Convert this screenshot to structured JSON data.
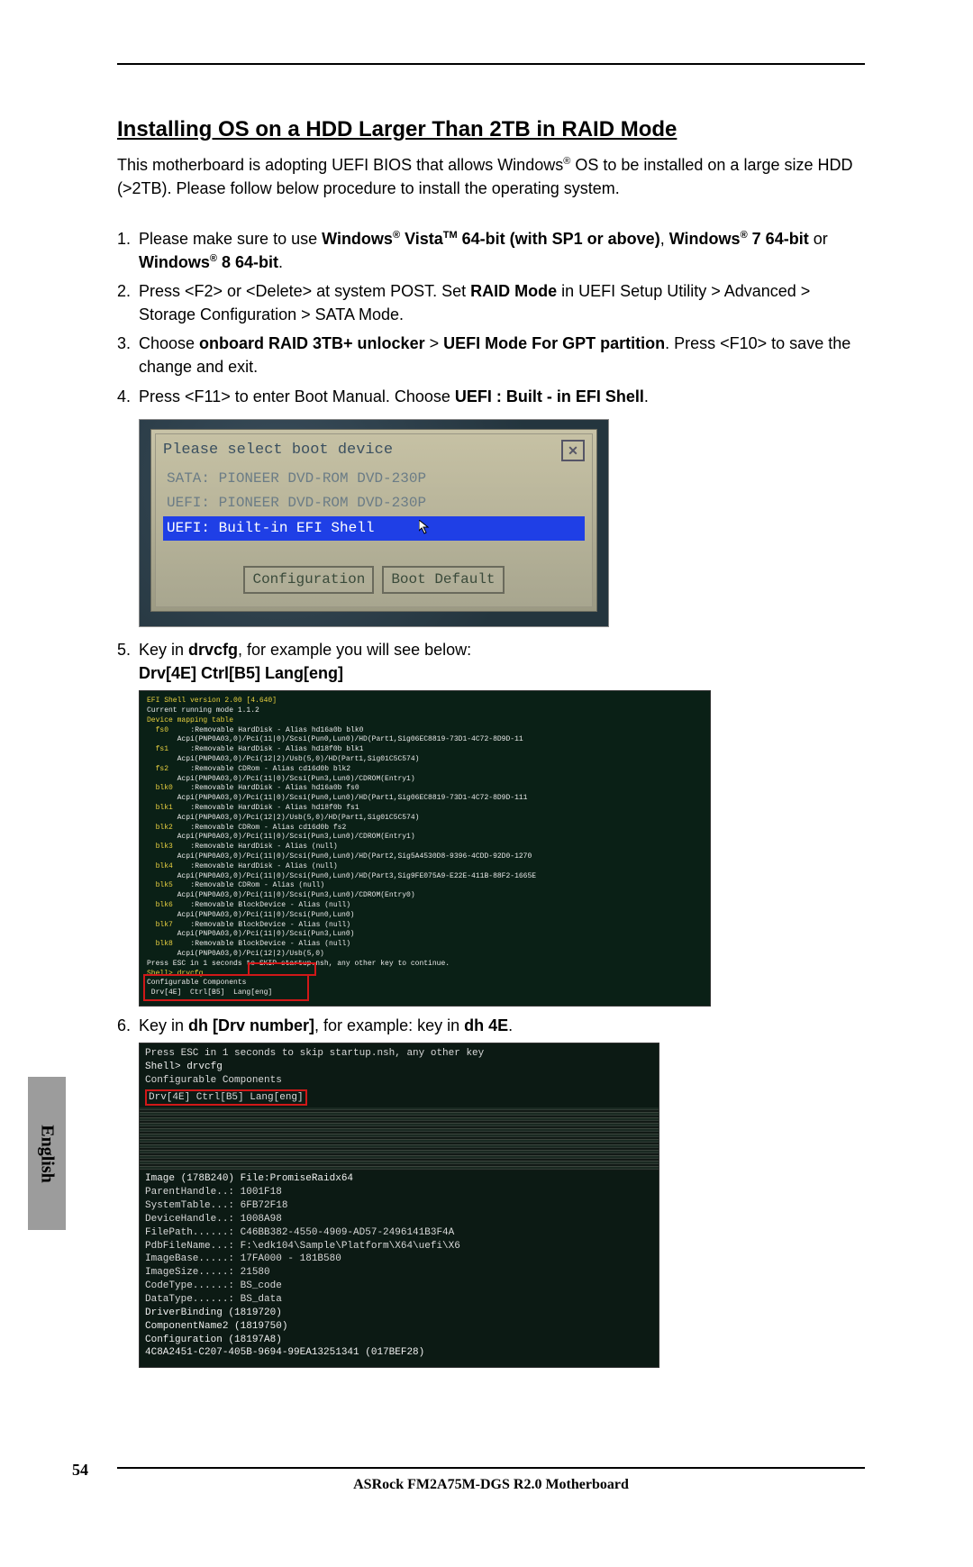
{
  "heading": "Installing OS on a HDD Larger Than 2TB in RAID Mode",
  "intro": {
    "t1": "This motherboard is adopting UEFI BIOS that allows Windows",
    "reg": "®",
    "t2": " OS to be installed on a large size HDD (>2TB). Please follow below procedure to install the operating system."
  },
  "s1": {
    "a": "Please make sure to use ",
    "b": "Windows",
    "c": " Vista",
    "tm": "TM",
    "d": " 64-bit (with SP1 or above)",
    "comma": ", ",
    "e": "Windows",
    "f": " 7 64-bit ",
    "g": "or ",
    "h": "Windows",
    "i": " 8 64-bit",
    "j": "."
  },
  "s2": {
    "a": "Press <F2> or <Delete> at system POST. Set ",
    "b": "RAID Mode",
    "c": " in UEFI Setup Utility > Advanced > Storage Configuration > SATA Mode."
  },
  "s3": {
    "a": "Choose ",
    "b": "onboard RAID 3TB+ unlocker",
    "c": " > ",
    "d": "UEFI Mode For GPT partition",
    "e": ". Press <F10> to save the change and exit."
  },
  "s4": {
    "a": "Press <F11> to enter Boot Manual. Choose ",
    "b": "UEFI : Built - in EFI Shell",
    "c": "."
  },
  "dlg": {
    "title": "Please select boot device",
    "o1": "SATA: PIONEER DVD-ROM DVD-230P",
    "o2": "UEFI: PIONEER DVD-ROM DVD-230P",
    "o3": "UEFI: Built-in EFI Shell",
    "b1": "Configuration",
    "b2": "Boot Default"
  },
  "s5": {
    "a": "Key in ",
    "b": "drvcfg",
    "c": ", for example you will see below:",
    "d": "Drv[4E]   Ctrl[B5]   Lang[eng]"
  },
  "shell": {
    "l1": "EFI Shell version 2.00 [4.640]",
    "l2": "Current running mode 1.1.2",
    "l3": "Device mapping table",
    "rows": [
      {
        "k": "fs0",
        "a": ":Removable HardDisk - Alias hd16a0b blk0",
        "b": "Acpi(PNP0A03,0)/Pci(11|0)/Scsi(Pun0,Lun0)/HD(Part1,Sig06EC8819-73D1-4C72-8D9D-11"
      },
      {
        "k": "fs1",
        "a": ":Removable HardDisk - Alias hd18f0b blk1",
        "b": "Acpi(PNP0A03,0)/Pci(12|2)/Usb(5,0)/HD(Part1,Sig01C5C574)"
      },
      {
        "k": "fs2",
        "a": ":Removable CDRom - Alias cd16d0b blk2",
        "b": "Acpi(PNP0A03,0)/Pci(11|0)/Scsi(Pun3,Lun0)/CDROM(Entry1)"
      },
      {
        "k": "blk0",
        "a": ":Removable HardDisk - Alias hd16a0b fs0",
        "b": "Acpi(PNP0A03,0)/Pci(11|0)/Scsi(Pun0,Lun0)/HD(Part1,Sig06EC8819-73D1-4C72-8D9D-111"
      },
      {
        "k": "blk1",
        "a": ":Removable HardDisk - Alias hd18f0b fs1",
        "b": "Acpi(PNP0A03,0)/Pci(12|2)/Usb(5,0)/HD(Part1,Sig01C5C574)"
      },
      {
        "k": "blk2",
        "a": ":Removable CDRom - Alias cd16d0b fs2",
        "b": "Acpi(PNP0A03,0)/Pci(11|0)/Scsi(Pun3,Lun0)/CDROM(Entry1)"
      },
      {
        "k": "blk3",
        "a": ":Removable HardDisk - Alias (null)",
        "b": "Acpi(PNP0A03,0)/Pci(11|0)/Scsi(Pun0,Lun0)/HD(Part2,Sig5A4530D8-9396-4CDD-92D0-1270"
      },
      {
        "k": "blk4",
        "a": ":Removable HardDisk - Alias (null)",
        "b": "Acpi(PNP0A03,0)/Pci(11|0)/Scsi(Pun0,Lun0)/HD(Part3,Sig9FE075A9-E22E-411B-88F2-1665E"
      },
      {
        "k": "blk5",
        "a": ":Removable CDRom - Alias (null)",
        "b": "Acpi(PNP0A03,0)/Pci(11|0)/Scsi(Pun3,Lun0)/CDROM(Entry0)"
      },
      {
        "k": "blk6",
        "a": ":Removable BlockDevice - Alias (null)",
        "b": "Acpi(PNP0A03,0)/Pci(11|0)/Scsi(Pun0,Lun0)"
      },
      {
        "k": "blk7",
        "a": ":Removable BlockDevice - Alias (null)",
        "b": "Acpi(PNP0A03,0)/Pci(11|0)/Scsi(Pun3,Lun0)"
      },
      {
        "k": "blk8",
        "a": ":Removable BlockDevice - Alias (null)",
        "b": "Acpi(PNP0A03,0)/Pci(12|2)/Usb(5,0)"
      }
    ],
    "press": "Press ESC in 1 seconds to SKIP startup.nsh, any other key to continue.",
    "sh": "Shell> drvcfg",
    "cc": "Configurable Components",
    "cl": " Drv[4E]  Ctrl[B5]  Lang[eng]"
  },
  "s6": {
    "a": "Key in ",
    "b": "dh [Drv number]",
    "c": ", for example: key in ",
    "d": "dh 4E",
    "e": "."
  },
  "sh3": {
    "l1": "Press ESC in 1 seconds to skip startup.nsh, any other key",
    "l2": "Shell> drvcfg",
    "l3": "Configurable Components",
    "l4": " Drv[4E]  Ctrl[B5]  Lang[eng]",
    "img": "Image (178B240)   File:PromiseRaidx64",
    "b1": " ParentHandle..: 1001F18",
    "b2": " SystemTable...: 6FB72F18",
    "b3": " DeviceHandle..: 1008A98",
    "b4": " FilePath......: C46BB382-4550-4909-AD57-2496141B3F4A",
    "b5": " PdbFileName...: F:\\edk104\\Sample\\Platform\\X64\\uefi\\X6",
    "b6": " ImageBase.....: 17FA000 - 181B580",
    "b7": " ImageSize.....: 21580",
    "b8": " CodeType......: BS_code",
    "b9": " DataType......: BS_data",
    "c1": "DriverBinding (1819720)",
    "c2": "ComponentName2 (1819750)",
    "c3": "Configuration (18197A8)",
    "c4": "4C8A2451-C207-405B-9694-99EA13251341 (017BEF28)"
  },
  "tab": "English",
  "page_no": "54",
  "footer": "ASRock  FM2A75M-DGS R2.0  Motherboard"
}
